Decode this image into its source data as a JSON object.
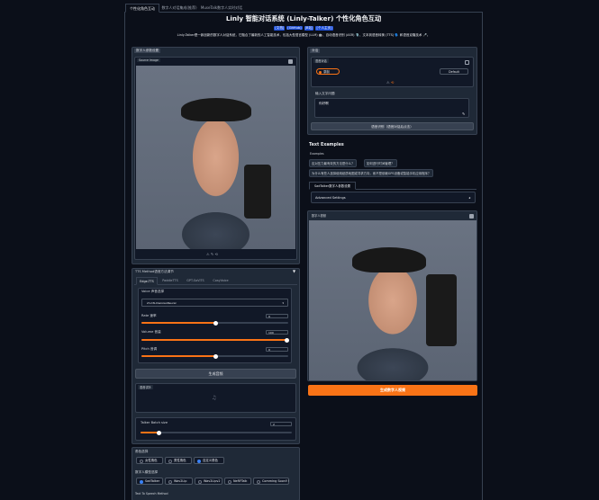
{
  "tabs": [
    "个性化角色互动",
    "数字人对话集成(推荐)",
    "MuseTalk数字人实时对话"
  ],
  "title": "Linly 智能对话系统 (Linly-Talker) 个性化角色互动",
  "links": [
    "[文档]",
    "[GitHub]",
    "[B站]",
    "[个人主页]"
  ],
  "intro": "Linly-Talker是一款创新的数字人对话系统，它融合了最新的人工智能技术，包括大型语言模型 (LLM) 🤖、自动语音识别 (ASR) 🎙️、文本到语音转换 (TTS) 🗣️ 和语音克隆技术 🎤。",
  "left": {
    "avatar_section": "数字人参数设置",
    "source_image_label": "Source Image",
    "tts_method_label": "TTS Method语音方法调节",
    "tts_tabs": [
      "Edge-TTS",
      "PaddleTTS",
      "GPT-SoVITS",
      "CosyVoice"
    ],
    "voice_label": "Voice 声音选择",
    "voice_value": "zh-CN-XiaoxiaoNeural",
    "rate_label": "Rate 速率",
    "rate_value": "0",
    "volume_label": "Volume 音量",
    "volume_value": "100",
    "pitch_label": "Pitch 音调",
    "pitch_value": "0",
    "generate_voice_btn": "生成音频",
    "audio_label": "语音试听",
    "batch_label": "Talker Batch size",
    "batch_value": "2",
    "role_label": "角色选择",
    "roles": [
      "女性角色",
      "男性角色",
      "自定义角色"
    ],
    "method_label": "数字人模型选择",
    "methods": [
      "SadTalker",
      "Wav2Lip",
      "Wav2Lipv2",
      "NeRFTalk",
      "Comming Soon!!!"
    ],
    "tts_method_footer": "Text To Speech Method"
  },
  "right": {
    "dialog_label": "对话",
    "voice_input_label": "语音对话",
    "record_btn": "录制",
    "device_select": "Default",
    "text_input_label": "输入文字问题",
    "text_input_value": "你好啊",
    "ask_btn": "语音识别（语音对话后点击）",
    "examples_title": "Text Examples",
    "examples_label": "Examples",
    "examples": [
      "应对压力最有效的方法是什么？",
      "如何进行时间管理？",
      "为什么有些人选择使用纸质地图或寻求方向，而不是依赖GPS设备或智能手机应用程序？"
    ],
    "sad_tab": "SadTalker数字人参数设置",
    "advanced_label": "Advanced Settings",
    "output_label": "数字人视频",
    "generate_btn": "生成数字人视频"
  }
}
